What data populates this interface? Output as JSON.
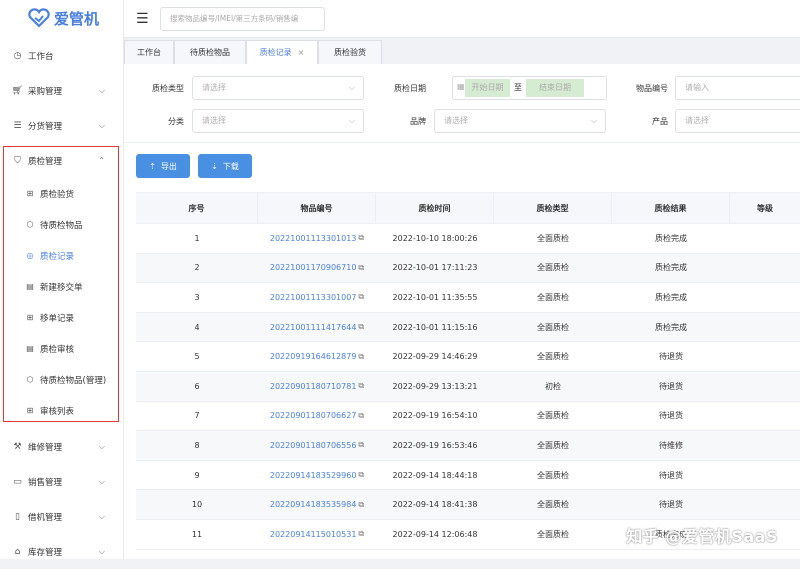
{
  "app": {
    "brand": "爱管机",
    "brand_color": "#4a7fe0"
  },
  "search": {
    "placeholder": "搜索物品编号/IMEI/第三方条码/销售编"
  },
  "sidebar": {
    "items": [
      {
        "label": "工作台",
        "icon": "clock-icon"
      },
      {
        "label": "采购管理",
        "icon": "cart-icon"
      },
      {
        "label": "分货管理",
        "icon": "list-icon"
      },
      {
        "label": "质检管理",
        "icon": "shield-icon"
      }
    ],
    "sub_items": [
      {
        "label": "质检验货",
        "icon": "grid-icon"
      },
      {
        "label": "待质检物品",
        "icon": "box-icon"
      },
      {
        "label": "质检记录",
        "icon": "compass-icon"
      },
      {
        "label": "新建移交单",
        "icon": "doc-icon"
      },
      {
        "label": "移单记录",
        "icon": "grid-icon"
      },
      {
        "label": "质检审核",
        "icon": "doc-icon"
      },
      {
        "label": "待质检物品(管理)",
        "icon": "box-icon"
      },
      {
        "label": "审核列表",
        "icon": "grid-icon"
      }
    ],
    "bottom_items": [
      {
        "label": "维修管理",
        "icon": "wrench-icon"
      },
      {
        "label": "销售管理",
        "icon": "sale-icon"
      },
      {
        "label": "借机管理",
        "icon": "phone-icon"
      },
      {
        "label": "库存管理",
        "icon": "home-icon"
      }
    ]
  },
  "tabs": [
    {
      "label": "工作台"
    },
    {
      "label": "待质检物品"
    },
    {
      "label": "质检记录",
      "close": "×"
    },
    {
      "label": "质检验货"
    }
  ],
  "filters": {
    "type_label": "质检类型",
    "type_placeholder": "请选择",
    "date_label": "质检日期",
    "date_start": "开始日期",
    "date_sep": "至",
    "date_end": "结束日期",
    "code_label": "物品编号",
    "code_placeholder": "请输入",
    "category_label": "分类",
    "category_placeholder": "请选择",
    "brand_label": "品牌",
    "brand_placeholder": "请选择",
    "product_label": "产品",
    "product_placeholder": "请选择"
  },
  "buttons": {
    "export": "导出",
    "download": "下载"
  },
  "table": {
    "headers": [
      "序号",
      "物品编号",
      "质检时间",
      "质检类型",
      "质检结果",
      "等级"
    ],
    "rows": [
      [
        "1",
        "20221001113301013",
        "2022-10-10 18:00:26",
        "全面质检",
        "质检完成"
      ],
      [
        "2",
        "20221001170906710",
        "2022-10-01 17:11:23",
        "全面质检",
        "质检完成"
      ],
      [
        "3",
        "20221001113301007",
        "2022-10-01 11:35:55",
        "全面质检",
        "质检完成"
      ],
      [
        "4",
        "20221001111417644",
        "2022-10-01 11:15:16",
        "全面质检",
        "质检完成"
      ],
      [
        "5",
        "20220919164612879",
        "2022-09-29 14:46:29",
        "全面质检",
        "待退货"
      ],
      [
        "6",
        "20220901180710781",
        "2022-09-29 13:13:21",
        "初检",
        "待退货"
      ],
      [
        "7",
        "20220901180706627",
        "2022-09-19 16:54:10",
        "全面质检",
        "待退货"
      ],
      [
        "8",
        "20220901180706556",
        "2022-09-19 16:53:46",
        "全面质检",
        "待维修"
      ],
      [
        "9",
        "20220914183529960",
        "2022-09-14 18:44:18",
        "全面质检",
        "待退货"
      ],
      [
        "10",
        "20220914183535984",
        "2022-09-14 18:41:38",
        "全面质检",
        "待退货"
      ],
      [
        "11",
        "20220914115010531",
        "2022-09-14 12:06:48",
        "全面质检",
        "质检完成"
      ]
    ]
  },
  "watermark": "知乎 @爱管机SaaS"
}
